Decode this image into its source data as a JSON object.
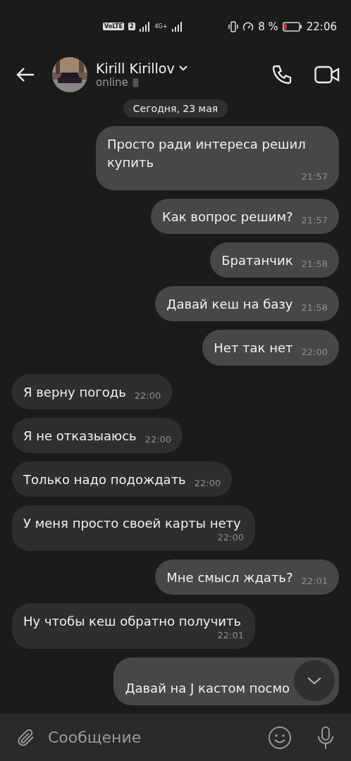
{
  "status_bar": {
    "badges": [
      "VoLTE",
      "2"
    ],
    "network_type": "4G+",
    "battery_text": "8 %",
    "time": "22:06"
  },
  "header": {
    "contact_name": "Kirill Kirillov",
    "presence": "online"
  },
  "date_label": "Сегодня, 23 мая",
  "messages": [
    {
      "kind": "outgoing",
      "text": "Просто ради интереса решил купить",
      "time": "21:57"
    },
    {
      "kind": "outgoing",
      "text": "Как вопрос решим?",
      "time": "21:57"
    },
    {
      "kind": "outgoing",
      "text": "Братанчик",
      "time": "21:58"
    },
    {
      "kind": "outgoing",
      "text": "Давай кеш на базу",
      "time": "21:58"
    },
    {
      "kind": "outgoing",
      "text": "Нет так нет",
      "time": "22:00"
    },
    {
      "kind": "incoming",
      "text": "Я верну погодь",
      "time": "22:00"
    },
    {
      "kind": "incoming",
      "text": "Я не отказыаюсь",
      "time": "22:00"
    },
    {
      "kind": "incoming",
      "text": "Только надо подождать",
      "time": "22:00"
    },
    {
      "kind": "incoming",
      "text": "У меня просто своей карты нету",
      "time": "22:00"
    },
    {
      "kind": "outgoing",
      "text": "Мне смысл ждать?",
      "time": "22:01"
    },
    {
      "kind": "incoming",
      "text": "Ну чтобы кеш обратно получить",
      "time": "22:01"
    },
    {
      "kind": "outgoing",
      "text": "Давай на J кастом посмо"
    }
  ],
  "composer": {
    "placeholder": "Сообщение"
  }
}
